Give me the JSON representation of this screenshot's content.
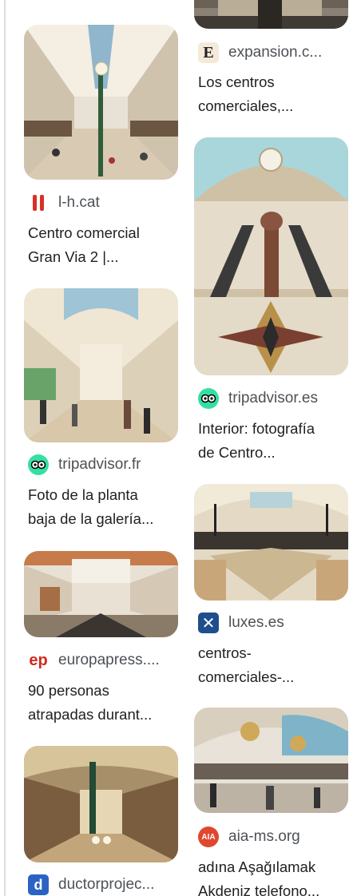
{
  "results": [
    {
      "source": "expansion.c...",
      "title_line1": "Los centros",
      "title_line2": "comerciales,...",
      "favicon": "E"
    },
    {
      "source": "l-h.cat",
      "title_line1": "Centro comercial",
      "title_line2": "Gran Via 2 |...",
      "favicon": "ll"
    },
    {
      "source": "tripadvisor.es",
      "title_line1": "Interior: fotografía",
      "title_line2": "de Centro...",
      "favicon": "owl-icon"
    },
    {
      "source": "tripadvisor.fr",
      "title_line1": "Foto de la planta",
      "title_line2": "baja de la galería...",
      "favicon": "owl-icon"
    },
    {
      "source": "luxes.es",
      "title_line1": "centros-",
      "title_line2": "comerciales-...",
      "favicon": "x-icon"
    },
    {
      "source": "europapress....",
      "title_line1": "90 personas",
      "title_line2": "atrapadas durant...",
      "favicon": "ep"
    },
    {
      "source": "aia-ms.org",
      "title_line1": "adına Aşağılamak",
      "title_line2": "Akdeniz telefono...",
      "favicon": "AIA"
    },
    {
      "source": "ductorprojec...",
      "title_line1": "",
      "title_line2": "",
      "favicon": "d"
    }
  ]
}
